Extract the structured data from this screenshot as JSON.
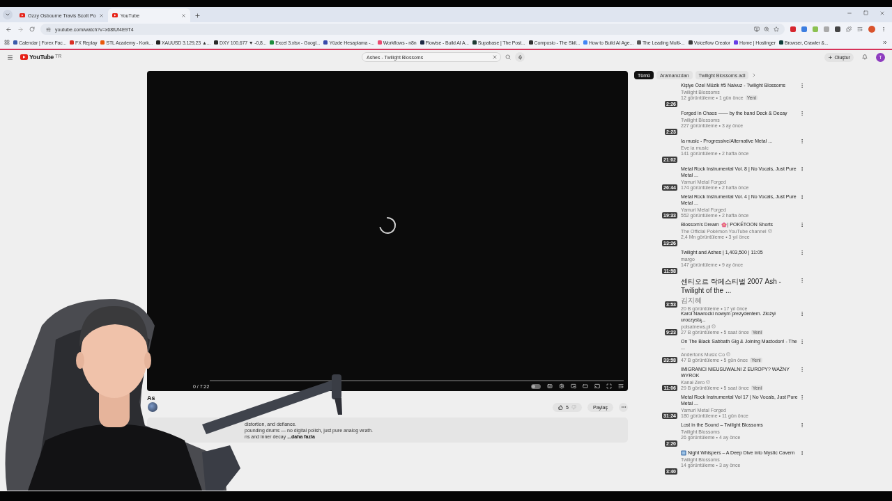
{
  "browser": {
    "tabs": [
      {
        "title": "Ozzy Osbourne Travis Scott Po",
        "selected": false
      },
      {
        "title": "YouTube",
        "selected": true
      }
    ],
    "url": "youtube.com/watch?v=x68tUf4E9T4",
    "bookmarks": [
      {
        "label": "Calendar | Forex Fac...",
        "color": "#3b5bab"
      },
      {
        "label": "FX Replay",
        "color": "#d93025"
      },
      {
        "label": "STL Academy - Kork...",
        "color": "#e8590c"
      },
      {
        "label": "XAUUSD 3.129,23 ▲...",
        "color": "#222222"
      },
      {
        "label": "DXY 100,677 ▼ -0,8...",
        "color": "#2a2a2a"
      },
      {
        "label": "Excel 3.xlsx - Googl...",
        "color": "#1e8e3e"
      },
      {
        "label": "Yüzde Hesaplama -...",
        "color": "#3949ab"
      },
      {
        "label": "Workflows - n8n",
        "color": "#ea4b71"
      },
      {
        "label": "Flowise - Build AI A...",
        "color": "#1f2a44"
      },
      {
        "label": "Supabase | The Post...",
        "color": "#1c3b32"
      },
      {
        "label": "Composio - The Skil...",
        "color": "#333333"
      },
      {
        "label": "How to Build AI Age...",
        "color": "#4285f4"
      },
      {
        "label": "The Leading Multi-...",
        "color": "#555555"
      },
      {
        "label": "Voiceflow Creator",
        "color": "#3c3c3c"
      },
      {
        "label": "Home | Hostinger",
        "color": "#673de6"
      },
      {
        "label": "Browser, Crawler &...",
        "color": "#0f3d3a"
      }
    ]
  },
  "header": {
    "logo": "YouTube",
    "region": "TR",
    "search": {
      "value": "Ashes - Twilight Blossoms"
    },
    "create": "Oluştur",
    "avatar": "T"
  },
  "player": {
    "time": "0 / 7:22",
    "loading": true,
    "autoplay": false
  },
  "video": {
    "title": "As",
    "likes": "5",
    "share": "Paylaş",
    "description": [
      "distortion, and defiance.",
      "pounding drums — no digital polish, just pure analog wrath.",
      "ns and inner decay"
    ],
    "more": "...daha fazla"
  },
  "chips": [
    {
      "label": "Tümü",
      "selected": true
    },
    {
      "label": "Aramanızdan",
      "selected": false
    },
    {
      "label": "Twilight Blossoms adl",
      "selected": false
    }
  ],
  "recommendations": [
    {
      "title": [
        {
          "text": "Kişiye Özel Müzik #5 Naivuz - Twilight Blossoms"
        }
      ],
      "channel": "Twilight Blossoms",
      "verified": false,
      "meta": "12 görüntüleme • 1 gün önce",
      "badge": "Yeni",
      "duration": "2:26"
    },
    {
      "title": [
        {
          "text": "Forged in Chaos —— by the band Deck & Decay"
        }
      ],
      "channel": "Twilight Blossoms",
      "verified": false,
      "meta": "227 görüntüleme • 3 ay önce",
      "duration": "2:23"
    },
    {
      "title": [
        {
          "text": "Ia music - Progressive/Alternative Metal ..."
        }
      ],
      "channel": "Eve ia music",
      "verified": false,
      "meta": "141 görüntüleme • 2 hafta önce",
      "duration": "21:02"
    },
    {
      "title": [
        {
          "text": "Metal Rock Instrumental Vol. 8 | No Vocals, Just Pure Metal ..."
        }
      ],
      "channel": "Yamuri Metal Forged",
      "verified": false,
      "meta": "174 görüntüleme • 2 hafta önce",
      "duration": "26:44"
    },
    {
      "title": [
        {
          "text": "Metal Rock Instrumental Vol. 4 | No Vocals, Just Pure Metal ..."
        }
      ],
      "channel": "Yamuri Metal Forged",
      "verified": false,
      "meta": "552 görüntüleme • 2 hafta önce",
      "duration": "19:33"
    },
    {
      "title": [
        {
          "text": "Blossom's Dream"
        },
        {
          "kind": "flower"
        },
        {
          "text": "| POKÉTOON Shorts"
        }
      ],
      "channel": "The Official Pokémon YouTube channel",
      "verified": true,
      "meta": "2,4 Mn görüntüleme • 3 yıl önce",
      "duration": "13:26"
    },
    {
      "title": [
        {
          "text": "Twilight and Ashes | 1,403,500 | 11:05"
        }
      ],
      "channel": "margo",
      "verified": false,
      "meta": "147 görüntüleme • 9 ay önce",
      "duration": "11:58"
    },
    {
      "title": [
        {
          "text": "센티오르 락페스티벌 2007 Ash - Twilight of the ..."
        }
      ],
      "channel": "김지혜",
      "verified": false,
      "meta": "20 B görüntüleme • 17 yıl önce",
      "duration": "3:53"
    },
    {
      "title": [
        {
          "text": "Karol Nawrocki nowym prezydentem. Złożył uroczystą..."
        }
      ],
      "channel": "polsatnews.pl",
      "verified": true,
      "meta": "27 B görüntüleme • 5 saat önce",
      "badge": "Yeni",
      "duration": "9:23"
    },
    {
      "title": [
        {
          "text": "On The Black Sabbath Gig & Joining Mastodon! - The ..."
        }
      ],
      "channel": "Andertons Music Co",
      "verified": true,
      "meta": "47 B görüntüleme • 5 gün önce",
      "badge": "Yeni",
      "duration": "33:58"
    },
    {
      "title": [
        {
          "text": "IMIGRANCI NIEUSUWALNI Z EUROPY? WAŻNY WYROK"
        }
      ],
      "channel": "Kanał Zero",
      "verified": true,
      "meta": "29 B görüntüleme • 5 saat önce",
      "badge": "Yeni",
      "duration": "11:06"
    },
    {
      "title": [
        {
          "text": "Metal Rock Instrumental Vol 17 | No Vocals, Just Pure Metal ..."
        }
      ],
      "channel": "Yamuri Metal Forged",
      "verified": false,
      "meta": "180 görüntüleme • 11 gün önce",
      "duration": "31:24"
    },
    {
      "title": [
        {
          "text": "Lost in the Sound – Twilight Blossoms"
        }
      ],
      "channel": "Twilight Blossoms",
      "verified": false,
      "meta": "26 görüntüleme • 4 ay önce",
      "duration": "2:20"
    },
    {
      "title": [
        {
          "kind": "book"
        },
        {
          "text": "Night Whispers – A Deep Dive into Mystic Cavern"
        }
      ],
      "channel": "Twilight Blossoms",
      "verified": false,
      "meta": "14 görüntüleme • 3 ay önce",
      "duration": "3:40"
    }
  ]
}
